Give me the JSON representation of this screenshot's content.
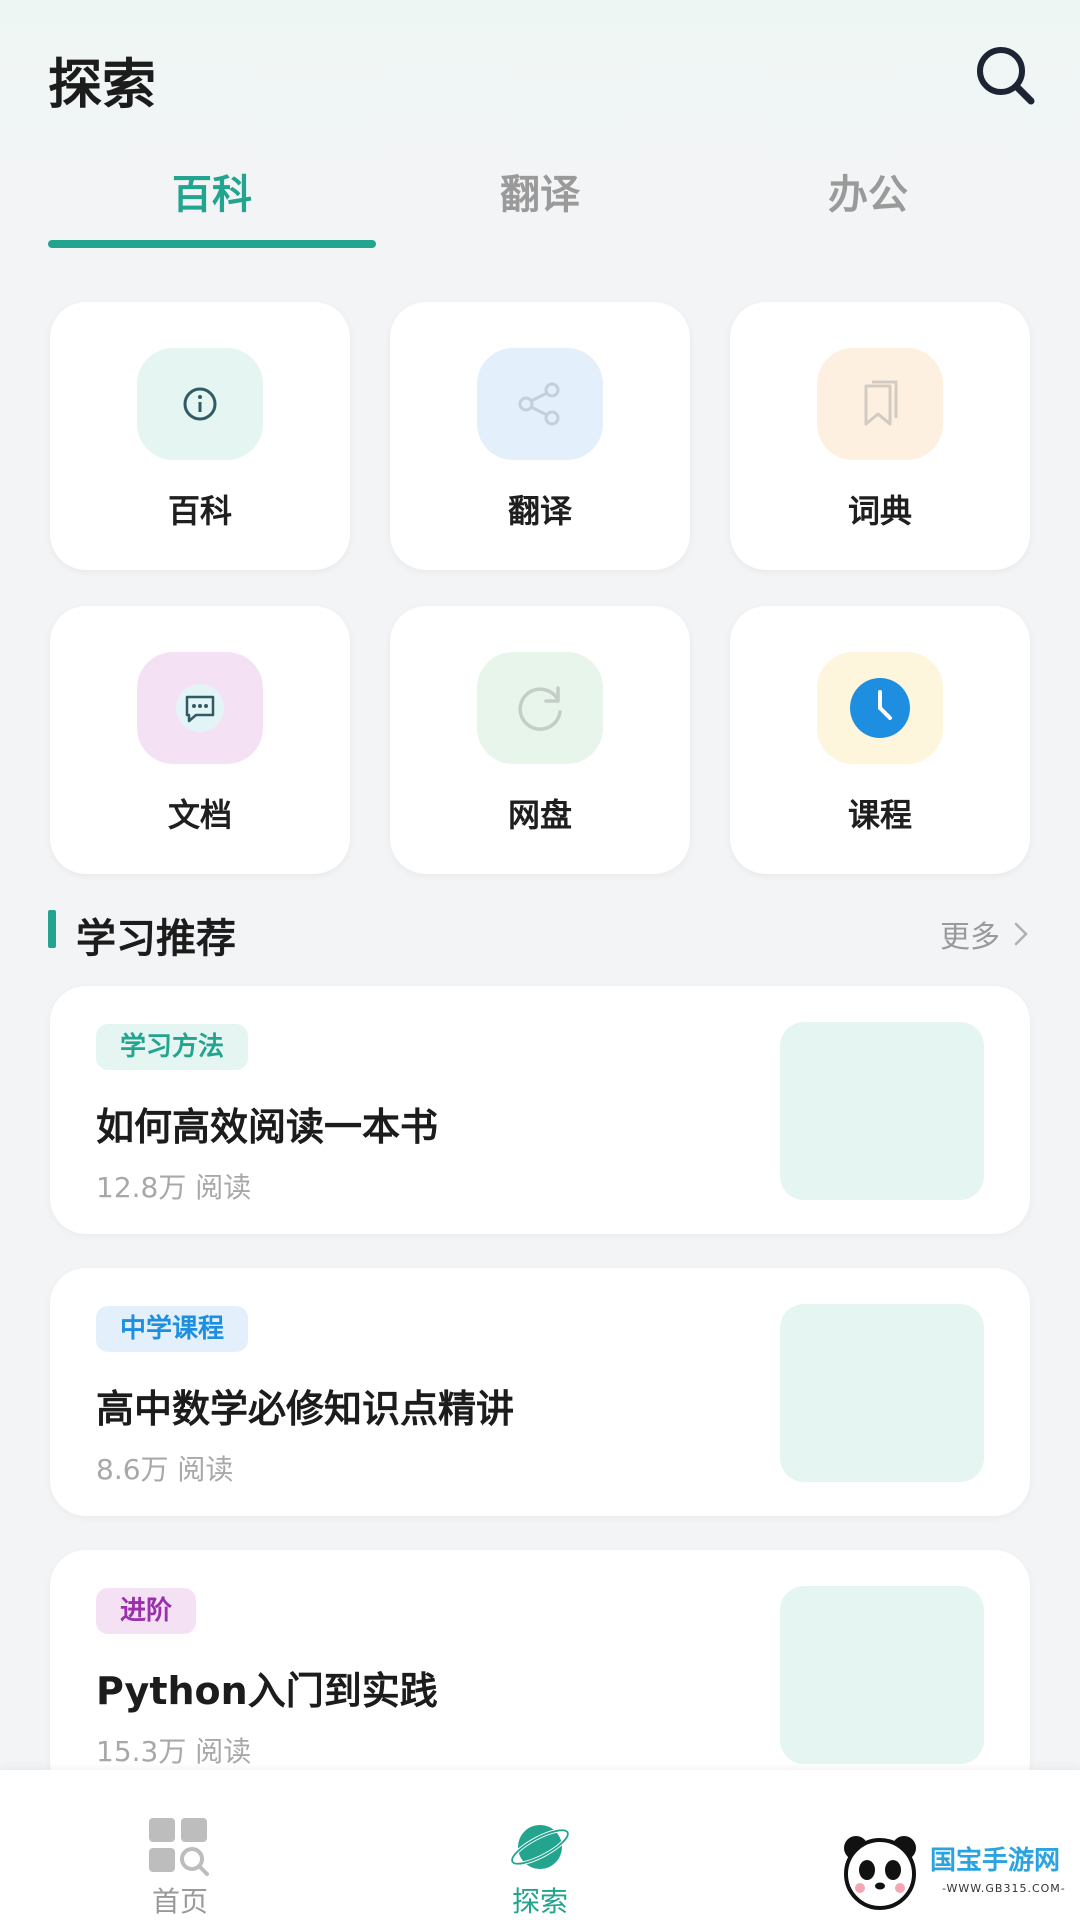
{
  "header": {
    "title": "探索"
  },
  "tabs": [
    {
      "label": "百科",
      "active": true
    },
    {
      "label": "翻译",
      "active": false
    },
    {
      "label": "办公",
      "active": false
    }
  ],
  "tools": [
    {
      "label": "百科",
      "icon": "info-icon",
      "bg": "#e5f5f1",
      "color": "#2f5a66"
    },
    {
      "label": "翻译",
      "icon": "share-icon",
      "bg": "#e3f0fb",
      "color": "#c9d3dc"
    },
    {
      "label": "词典",
      "icon": "bookmark-icon",
      "bg": "#fdf0e0",
      "color": "#d6d0c8"
    },
    {
      "label": "文档",
      "icon": "message-icon",
      "bg": "#f4e2f4",
      "color": "#2f5a66"
    },
    {
      "label": "网盘",
      "icon": "refresh-icon",
      "bg": "#e7f5ea",
      "color": "#c8d3cb"
    },
    {
      "label": "课程",
      "icon": "clock-icon",
      "bg": "#fdf6dc",
      "color": "#1e8fe0"
    }
  ],
  "section": {
    "title": "学习推荐",
    "more_label": "更多"
  },
  "articles": [
    {
      "tag": "学习方法",
      "tag_color": "#23a48f",
      "tag_bg": "#e5f5f1",
      "title": "如何高效阅读一本书",
      "reads": "12.8万 阅读"
    },
    {
      "tag": "中学课程",
      "tag_color": "#1e8fe0",
      "tag_bg": "#e3f0fb",
      "title": "高中数学必修知识点精讲",
      "reads": "8.6万 阅读"
    },
    {
      "tag": "进阶",
      "tag_color": "#9b2fae",
      "tag_bg": "#f4e2f4",
      "title": "Python入门到实践",
      "reads": "15.3万 阅读"
    }
  ],
  "bottom_nav": [
    {
      "label": "首页",
      "icon": "home-grid-icon",
      "active": false
    },
    {
      "label": "探索",
      "icon": "planet-icon",
      "active": true
    }
  ],
  "watermark": {
    "text": "国宝手游网",
    "sub": "-WWW.GB315.COM-"
  },
  "colors": {
    "accent": "#23a48f",
    "muted": "#9a9a9a"
  }
}
